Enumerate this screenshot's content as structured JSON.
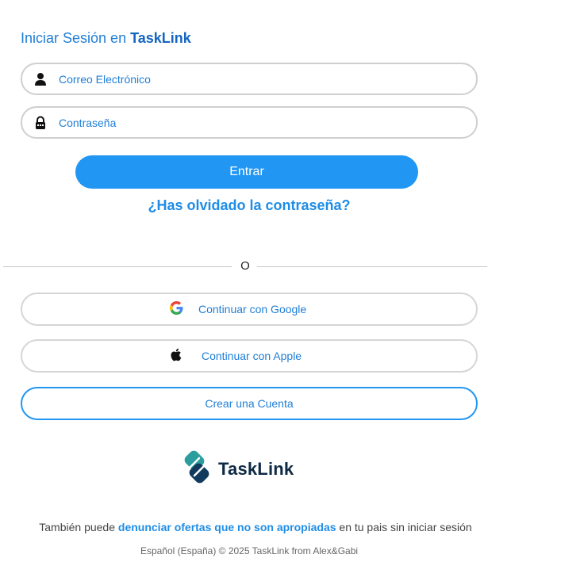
{
  "login": {
    "title_prefix": "Iniciar Sesión en",
    "title_brand": "TaskLink",
    "email_placeholder": "Correo Electrónico",
    "password_placeholder": "Contraseña",
    "submit_label": "Entrar",
    "forgot_label": "¿Has olvidado la contraseña?"
  },
  "divider": {
    "label": "O"
  },
  "oauth": {
    "google_label": "Continuar con Google",
    "apple_label": "Continuar con Apple"
  },
  "create_account_label": "Crear una Cuenta",
  "logo": {
    "text": "TaskLink"
  },
  "footer": {
    "prefix": "También puede",
    "link": "denunciar ofertas que no son apropiadas",
    "suffix": "en tu pais sin iniciar sesión",
    "copyright": "Español (España) © 2025 TaskLink from Alex&Gabi"
  },
  "icons": {
    "email": "user-icon",
    "password": "lock-icon",
    "google": "google-icon",
    "apple": "apple-icon"
  },
  "colors": {
    "accent": "#2196f3",
    "text_link": "#1f7ed6",
    "brand_dark": "#0f2a45",
    "brand_teal": "#1e8a8a"
  }
}
